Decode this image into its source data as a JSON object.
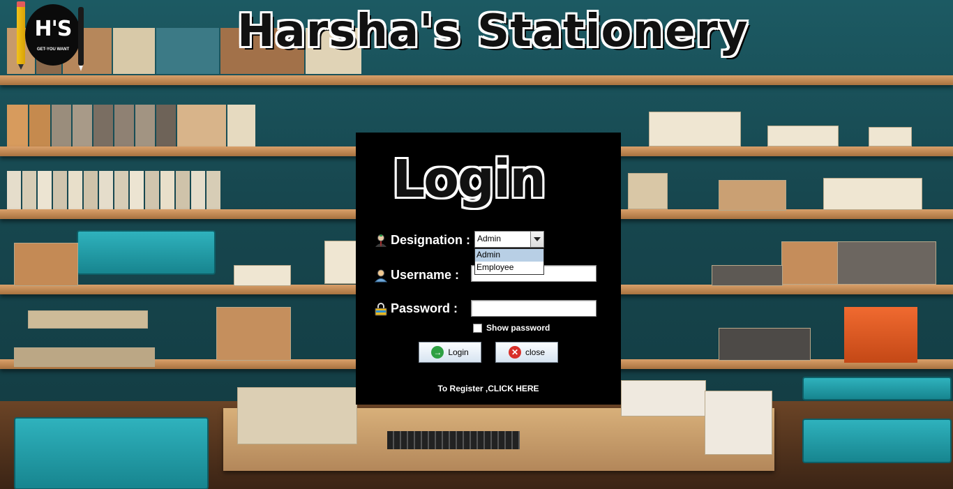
{
  "app": {
    "title": "Harsha's Stationery",
    "logo_text": "H'S",
    "logo_tagline": "GET-YOU WANT"
  },
  "login": {
    "title": "Login",
    "designation_label": "Designation :",
    "designation_selected": "Admin",
    "designation_options": [
      "Admin",
      "Employee"
    ],
    "username_label": "Username :",
    "username_value": "",
    "password_label": "Password :",
    "password_value": "",
    "show_password_label": "Show password",
    "login_button": "Login",
    "close_button": "close",
    "register_link": "To Register ,CLICK HERE"
  },
  "icons": {
    "designation": "manager-icon",
    "username": "user-icon",
    "password": "lock-icon",
    "login": "login-arrow-icon",
    "close": "close-x-icon"
  },
  "colors": {
    "panel": "#000000",
    "button_gradient_top": "#fbfdff",
    "button_gradient_bottom": "#d7e4f1",
    "login_icon": "#2ea043",
    "close_icon": "#d8302a",
    "selected_option": "#b8cfe5"
  }
}
